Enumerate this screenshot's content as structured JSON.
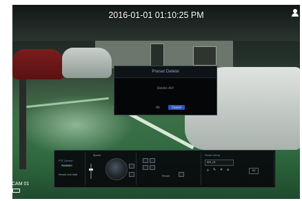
{
  "overlay": {
    "timestamp": "2016-01-01 01:10:25 PM",
    "camera_label": "CAM 01"
  },
  "dialog": {
    "title": "Preset Delete",
    "message": "Delete All?",
    "ok_label": "OK",
    "cancel_label": "Cancel"
  },
  "ptz_panel": {
    "title": "PTZ Control",
    "mode": "PANNING",
    "sub_label": "Preset List Hold",
    "speed_label": "Speed",
    "preset_label": "Preset",
    "preset_setup_title": "Preset Setup",
    "preset_input_value": "001_01",
    "close_label": "OK"
  },
  "colors": {
    "dialog_accent": "#2f56b8",
    "ptz_title": "#7d9bd8"
  },
  "icons": [
    "user-icon",
    "hdd-icon"
  ]
}
